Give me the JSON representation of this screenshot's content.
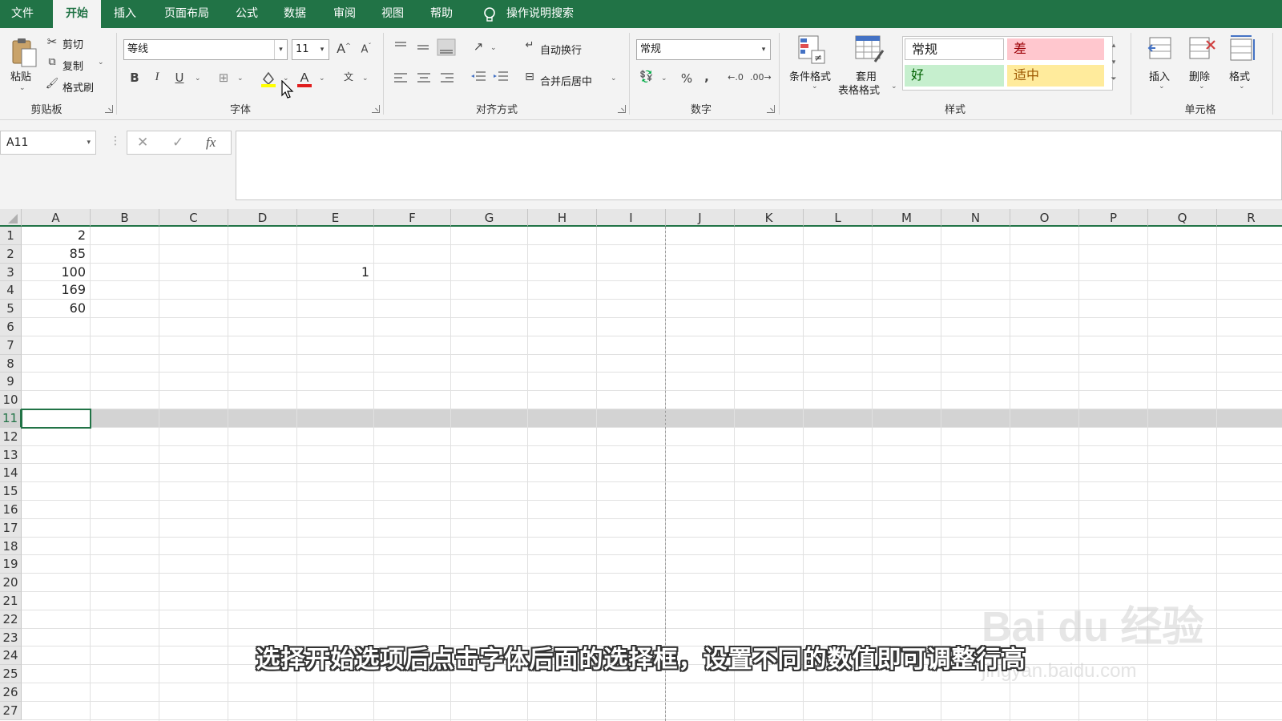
{
  "menubar": {
    "tabs": [
      "文件",
      "开始",
      "插入",
      "页面布局",
      "公式",
      "数据",
      "审阅",
      "视图",
      "帮助"
    ],
    "active_tab": "开始",
    "tell_me": "操作说明搜索"
  },
  "clipboard": {
    "paste": "粘贴",
    "cut": "剪切",
    "copy": "复制",
    "format_painter": "格式刷",
    "title": "剪贴板"
  },
  "font": {
    "font_name": "等线",
    "font_size": "11",
    "bold": "B",
    "italic": "I",
    "underline": "U",
    "title": "字体"
  },
  "alignment": {
    "wrap_text": "自动换行",
    "merge_center": "合并后居中",
    "title": "对齐方式"
  },
  "number": {
    "format": "常规",
    "percent": "%",
    "comma": ",",
    "title": "数字"
  },
  "styles": {
    "conditional_format": "条件格式",
    "format_as_table_1": "套用",
    "format_as_table_2": "表格格式",
    "normal": "常规",
    "bad": "差",
    "good": "好",
    "neutral": "适中",
    "title": "样式"
  },
  "cells": {
    "insert": "插入",
    "delete": "删除",
    "format": "格式",
    "title": "单元格"
  },
  "formula_bar": {
    "name_box": "A11",
    "cancel": "✕",
    "enter": "✓",
    "fx": "fx",
    "formula": ""
  },
  "sheet": {
    "columns": [
      "A",
      "B",
      "C",
      "D",
      "E",
      "F",
      "G",
      "H",
      "I",
      "J",
      "K",
      "L",
      "M",
      "N",
      "O",
      "P",
      "Q",
      "R"
    ],
    "rows": [
      "1",
      "2",
      "3",
      "4",
      "5",
      "6",
      "7",
      "8",
      "9",
      "10",
      "11",
      "12",
      "13",
      "14",
      "15",
      "16",
      "17",
      "18",
      "19",
      "20",
      "21",
      "22",
      "23",
      "24",
      "25",
      "26",
      "27"
    ],
    "selected_row": "11",
    "cells": {
      "A1": "2",
      "A2": "85",
      "A3": "100",
      "A4": "169",
      "A5": "60",
      "E3": "1"
    }
  },
  "overlay": {
    "subtitle": "选择开始选项后点击字体后面的选择框，设置不同的数值即可调整行高",
    "watermark": "Bai du 经验",
    "watermark_url": "jingyan.baidu.com"
  },
  "colors": {
    "accent": "#217346",
    "bad_bg": "#ffc7ce",
    "bad_fg": "#9c0006",
    "good_bg": "#c6efce",
    "good_fg": "#006100",
    "neutral_bg": "#ffeb9c",
    "neutral_fg": "#9c5700"
  }
}
